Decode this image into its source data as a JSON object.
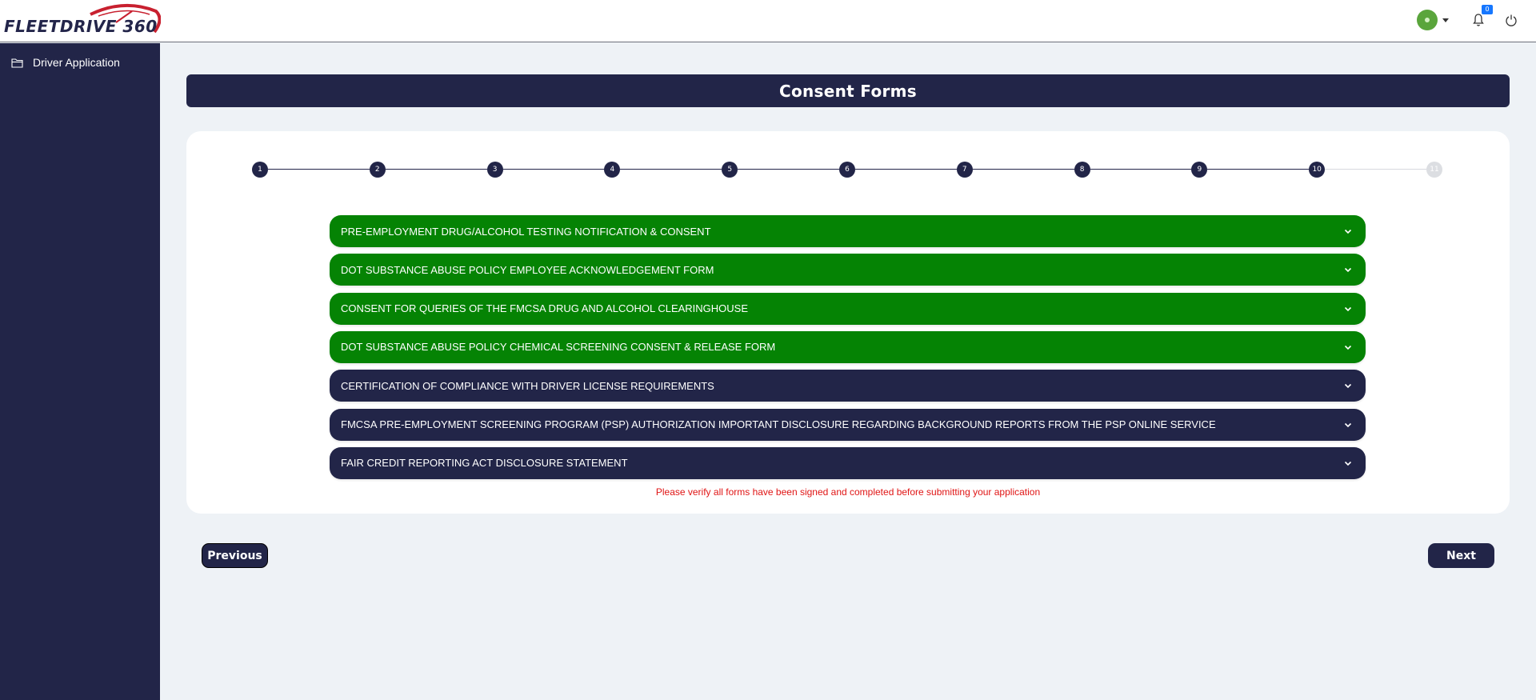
{
  "app": {
    "brand_name": "FLEETDRIVE 360"
  },
  "header": {
    "avatar_icon": "user-avatar-icon",
    "notification_count": "0",
    "icons": [
      "chevron-down-icon",
      "bell-icon",
      "power-icon"
    ]
  },
  "sidebar": {
    "items": [
      {
        "label": "Driver Application",
        "icon": "folder-icon"
      }
    ]
  },
  "page": {
    "title": "Consent Forms"
  },
  "stepper": {
    "steps": [
      "1",
      "2",
      "3",
      "4",
      "5",
      "6",
      "7",
      "8",
      "9",
      "10",
      "11"
    ],
    "current_step": 10,
    "active_color": "#222548",
    "inactive_color": "#dcdee2"
  },
  "forms": [
    {
      "label": "PRE-EMPLOYMENT DRUG/ALCOHOL TESTING NOTIFICATION & CONSENT",
      "status": "completed"
    },
    {
      "label": "DOT SUBSTANCE ABUSE POLICY EMPLOYEE ACKNOWLEDGEMENT FORM",
      "status": "completed"
    },
    {
      "label": "CONSENT FOR QUERIES OF THE FMCSA DRUG AND ALCOHOL CLEARINGHOUSE",
      "status": "completed"
    },
    {
      "label": "DOT SUBSTANCE ABUSE POLICY CHEMICAL SCREENING CONSENT & RELEASE FORM",
      "status": "completed"
    },
    {
      "label": "CERTIFICATION OF COMPLIANCE WITH DRIVER LICENSE REQUIREMENTS",
      "status": "pending"
    },
    {
      "label": "FMCSA PRE-EMPLOYMENT SCREENING PROGRAM (PSP) AUTHORIZATION IMPORTANT DISCLOSURE REGARDING BACKGROUND REPORTS FROM THE PSP ONLINE SERVICE",
      "status": "pending"
    },
    {
      "label": "FAIR CREDIT REPORTING ACT DISCLOSURE STATEMENT",
      "status": "pending"
    }
  ],
  "colors": {
    "completed": "#058304",
    "pending": "#222548",
    "warning": "#e01515"
  },
  "warning_text": "Please verify all forms have been signed and completed before submitting your application",
  "nav": {
    "previous_label": "Previous",
    "next_label": "Next"
  }
}
